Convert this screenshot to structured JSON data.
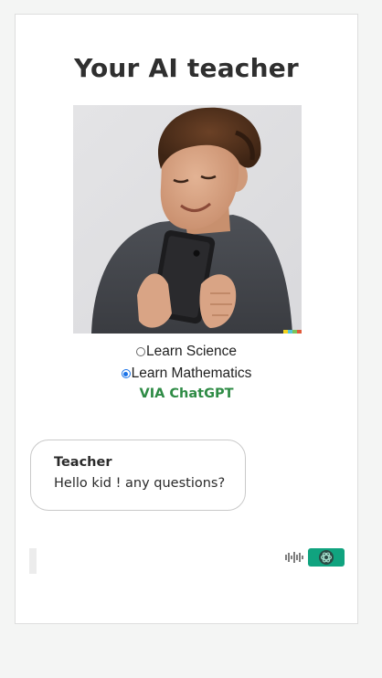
{
  "page": {
    "title": "Your AI teacher",
    "options": [
      {
        "label": "Learn Science",
        "selected": false
      },
      {
        "label": "Learn Mathematics",
        "selected": true
      }
    ],
    "via": "VIA ChatGPT"
  },
  "chat": {
    "messages": [
      {
        "sender": "Teacher",
        "text": "Hello kid ! any questions?"
      }
    ]
  },
  "input": {
    "value": "",
    "mic_icon": "waveform-icon",
    "send_icon": "openai-logo-icon"
  },
  "colors": {
    "accent_green": "#10a37f",
    "via_text": "#2e8b45",
    "radio_selected": "#1a73e8"
  }
}
